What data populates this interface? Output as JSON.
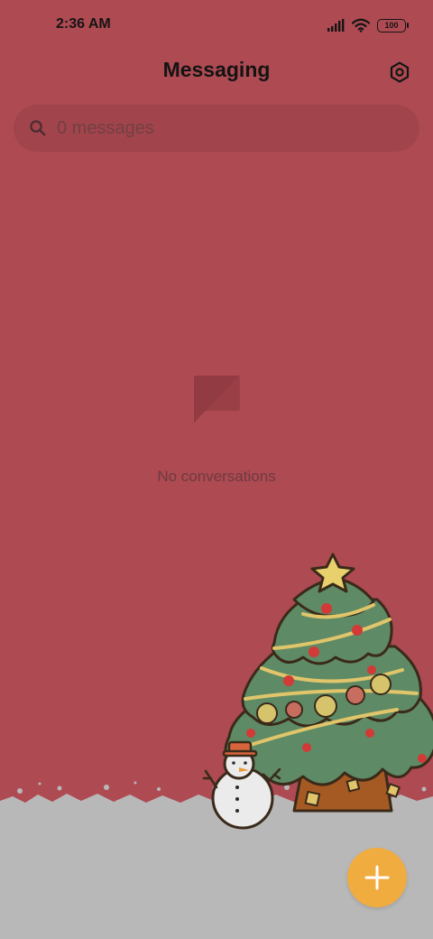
{
  "status_bar": {
    "time": "2:36 AM",
    "battery": "100",
    "icons": [
      "signal-icon",
      "wifi-icon",
      "battery-icon"
    ]
  },
  "header": {
    "title": "Messaging",
    "settings_icon": "settings-icon"
  },
  "search": {
    "placeholder": "0 messages",
    "icon": "search-icon"
  },
  "empty_state": {
    "icon": "chat-bubble-icon",
    "text": "No conversations"
  },
  "fab": {
    "icon": "plus-icon",
    "color": "#f1ac40"
  },
  "theme": {
    "background": "#ae4a52",
    "snow": "#b8b8b8",
    "accent": "#f1ac40"
  }
}
